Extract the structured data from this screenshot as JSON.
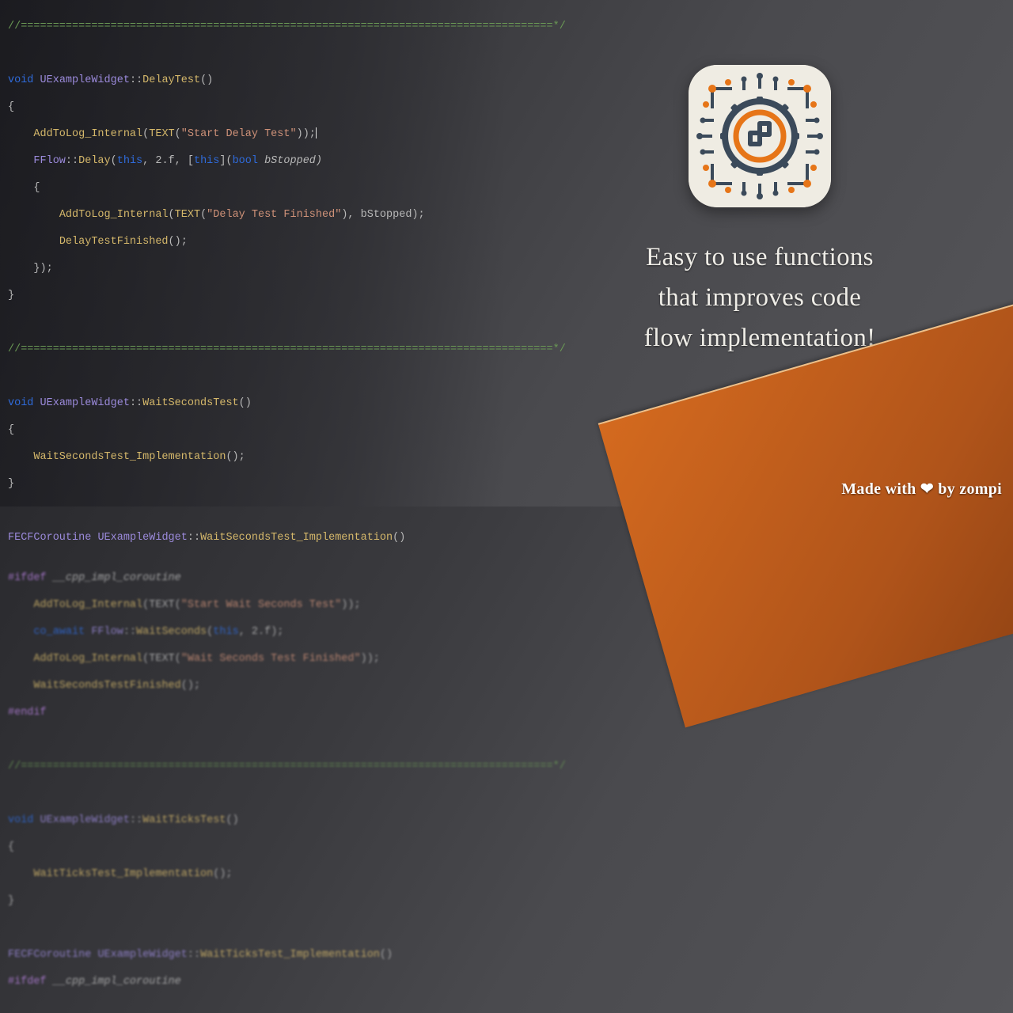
{
  "code": {
    "sep": "//===================================================================================*/",
    "l1": "void",
    "l1b": "UExampleWidget",
    "l1c": "::",
    "l1d": "DelayTest",
    "l1e": "()",
    "l2": "{",
    "l3a": "AddToLog_Internal",
    "l3b": "(",
    "l3c": "TEXT",
    "l3d": "(",
    "l3e": "\"Start Delay Test\"",
    "l3f": "));",
    "l4a": "FFlow",
    "l4b": "::",
    "l4c": "Delay",
    "l4d": "(",
    "l4e": "this",
    "l4f": ", 2.f, [",
    "l4g": "this",
    "l4h": "](",
    "l4i": "bool",
    "l4j": " bStopped)",
    "l5": "{",
    "l6a": "AddToLog_Internal",
    "l6b": "(",
    "l6c": "TEXT",
    "l6d": "(",
    "l6e": "\"Delay Test Finished\"",
    "l6f": "), bStopped);",
    "l7a": "DelayTestFinished",
    "l7b": "();",
    "l8": "});",
    "l9": "}",
    "w1a": "void",
    "w1b": "UExampleWidget",
    "w1c": "::",
    "w1d": "WaitSecondsTest",
    "w1e": "()",
    "w2": "{",
    "w3a": "WaitSecondsTest_Implementation",
    "w3b": "();",
    "w4": "}",
    "w5a": "FECFCoroutine",
    "w5b": "UExampleWidget",
    "w5c": "::",
    "w5d": "WaitSecondsTest_Implementation",
    "w5e": "()",
    "w6a": "#ifdef",
    "w6b": "__cpp_impl_coroutine",
    "w7a": "AddToLog_Internal",
    "w7b": "(TEXT(",
    "w7c": "\"Start Wait Seconds Test\"",
    "w7d": "));",
    "w8a": "co_await",
    "w8b": "FFlow",
    "w8c": "::",
    "w8d": "WaitSeconds",
    "w8e": "(",
    "w8f": "this",
    "w8g": ", 2.f);",
    "w9a": "AddToLog_Internal",
    "w9b": "(TEXT(",
    "w9c": "\"Wait Seconds Test Finished\"",
    "w9d": "));",
    "w10a": "WaitSecondsTestFinished",
    "w10b": "();",
    "w11": "#endif",
    "t1a": "void",
    "t1b": "UExampleWidget",
    "t1c": "::",
    "t1d": "WaitTicksTest",
    "t1e": "()",
    "t2": "{",
    "t3a": "WaitTicksTest_Implementation",
    "t3b": "();",
    "t4": "}",
    "t5a": "FECFCoroutine",
    "t5b": "UExampleWidget",
    "t5c": "::",
    "t5d": "WaitTicksTest_Implementation",
    "t5e": "()",
    "t6a": "#ifdef",
    "t6b": "__cpp_impl_coroutine"
  },
  "tagline": {
    "line1": "Easy to use functions",
    "line2": "that improves code",
    "line3": "flow implementation!"
  },
  "credit": {
    "prefix": "Made with ",
    "heart": "❤",
    "suffix": " by zompi"
  }
}
